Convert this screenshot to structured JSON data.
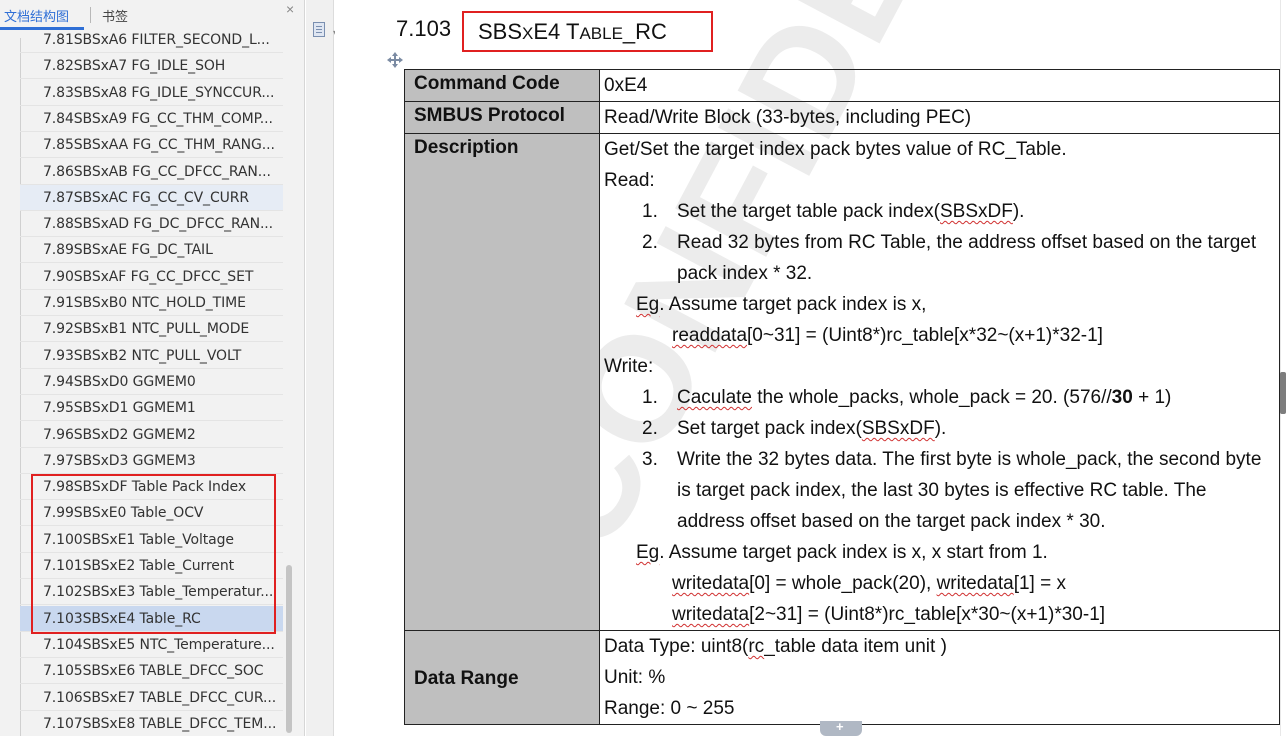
{
  "nav": {
    "tabs": {
      "outline": "文档结构图",
      "bookmark": "书签"
    },
    "close_glyph": "×",
    "items": [
      {
        "label": "7.81SBSxA6 FILTER_SECOND_L..."
      },
      {
        "label": "7.82SBSxA7 FG_IDLE_SOH"
      },
      {
        "label": "7.83SBSxA8 FG_IDLE_SYNCCUR..."
      },
      {
        "label": "7.84SBSxA9 FG_CC_THM_COMP..."
      },
      {
        "label": "7.85SBSxAA FG_CC_THM_RANG..."
      },
      {
        "label": "7.86SBSxAB FG_CC_DFCC_RAN..."
      },
      {
        "label": "7.87SBSxAC FG_CC_CV_CURR"
      },
      {
        "label": "7.88SBSxAD FG_DC_DFCC_RAN..."
      },
      {
        "label": "7.89SBSxAE FG_DC_TAIL"
      },
      {
        "label": "7.90SBSxAF FG_CC_DFCC_SET"
      },
      {
        "label": "7.91SBSxB0 NTC_HOLD_TIME"
      },
      {
        "label": "7.92SBSxB1 NTC_PULL_MODE"
      },
      {
        "label": "7.93SBSxB2 NTC_PULL_VOLT"
      },
      {
        "label": "7.94SBSxD0 GGMEM0"
      },
      {
        "label": "7.95SBSxD1 GGMEM1"
      },
      {
        "label": "7.96SBSxD2 GGMEM2"
      },
      {
        "label": "7.97SBSxD3 GGMEM3"
      },
      {
        "label": "7.98SBSxDF Table Pack Index"
      },
      {
        "label": "7.99SBSxE0 Table_OCV"
      },
      {
        "label": "7.100SBSxE1 Table_Voltage"
      },
      {
        "label": "7.101SBSxE2 Table_Current"
      },
      {
        "label": "7.102SBSxE3 Table_Temperatur..."
      },
      {
        "label": "7.103SBSxE4 Table_RC"
      },
      {
        "label": "7.104SBSxE5 NTC_Temperature..."
      },
      {
        "label": "7.105SBSxE6 TABLE_DFCC_SOC"
      },
      {
        "label": "7.106SBSxE7 TABLE_DFCC_CUR..."
      },
      {
        "label": "7.107SBSxE8 TABLE_DFCC_TEM..."
      }
    ],
    "hover_index": 6,
    "active_index": 22
  },
  "doc": {
    "section_number": "7.103",
    "section_title_a": "SBS",
    "section_title_b": "X",
    "section_title_c": "E4 T",
    "section_title_d": "ABLE",
    "section_title_e": "_RC",
    "table": {
      "command_code_label": "Command Code",
      "command_code_value": "0xE4",
      "protocol_label": "SMBUS Protocol",
      "protocol_value": "Read/Write Block (33-bytes, including PEC)",
      "description_label": "Description",
      "desc_intro": "Get/Set the target index pack bytes value of RC_Table.",
      "read_heading": "Read:",
      "read_step1_num": "1.",
      "read_step1_pre": "Set the target table pack index(",
      "read_step1_code": "SBSxDF",
      "read_step1_post": ").",
      "read_step2_num": "2.",
      "read_step2_line1": "Read 32 bytes from RC Table, the address offset based on the target",
      "read_step2_line2": "pack index * 32.",
      "read_eg_mark": "Eg",
      "read_eg_text": ". Assume target pack index is x,",
      "read_code_mark": "readdata",
      "read_code_rest": "[0~31] = (Uint8*)rc_table[x*32~(x+1)*32-1]",
      "write_heading": "Write:",
      "write_step1_num": "1.",
      "write_step1_mark": "Caculate",
      "write_step1_pre": " the whole_packs, whole_pack = 20. (576//",
      "write_step1_bold": "30",
      "write_step1_post": " + 1)",
      "write_step2_num": "2.",
      "write_step2_pre": "Set target pack index(",
      "write_step2_code": "SBSxDF",
      "write_step2_post": ").",
      "write_step3_num": "3.",
      "write_step3_line1": "Write the 32 bytes data. The first byte is whole_pack, the second byte",
      "write_step3_line2": "is target pack index, the last 30 bytes is effective RC table. The",
      "write_step3_line3": "address offset based on the target pack index * 30.",
      "write_eg_mark": "Eg",
      "write_eg_text": ". Assume target pack index is x, x start from 1.",
      "write_code1_mark": "writedata",
      "write_code1_mid": "[0] = whole_pack(20), ",
      "write_code1_mark2": "writedata",
      "write_code1_rest": "[1] = x",
      "write_code2_mark": "writedata",
      "write_code2_rest": "[2~31] = (Uint8*)rc_table[x*30~(x+1)*30-1]",
      "data_range_label": "Data Range",
      "dr_type_pre": "Data Type: uint8(",
      "dr_type_mark": "rc",
      "dr_type_post": "_table data item unit )",
      "dr_unit": "Unit: %",
      "dr_range": "Range: 0 ~ 255"
    },
    "watermark_text": "CONFIDENTIAL",
    "watermark_color": "#ececec"
  },
  "colors": {
    "accent": "#2f6fd6",
    "highlight_box": "#e02020",
    "label_cell_bg": "#bfbfbf",
    "nav_active_bg": "#c9d8ef"
  }
}
